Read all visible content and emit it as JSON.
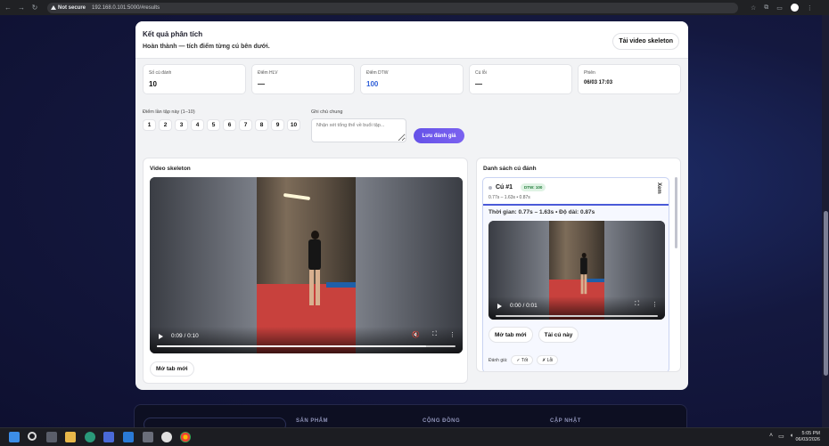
{
  "browser": {
    "security": "Not secure",
    "url": "192.168.0.101:5000/#results"
  },
  "header": {
    "title": "Kết quả phân tích",
    "subtitle": "Hoàn thành — tích điểm từng cú bên dưới.",
    "download_button": "Tải video skeleton"
  },
  "stats": [
    {
      "label": "Số cú đánh",
      "value": "10"
    },
    {
      "label": "Điểm HLV",
      "value": "—"
    },
    {
      "label": "Điểm DTW",
      "value": "100"
    },
    {
      "label": "Cú lỗi",
      "value": "—"
    },
    {
      "label": "Phiên",
      "value": "06/03 17:03"
    }
  ],
  "rating": {
    "label": "Điểm lần tập này (1–10)",
    "options": [
      "1",
      "2",
      "3",
      "4",
      "5",
      "6",
      "7",
      "8",
      "9",
      "10"
    ]
  },
  "note": {
    "label": "Ghi chú chung",
    "placeholder": "Nhận xét tổng thể về buổi tập..."
  },
  "save_button": "Lưu đánh giá",
  "video_panel": {
    "title": "Video skeleton",
    "time": "0:09 / 0:10",
    "progress": 0.9,
    "open_tab": "Mở tab mới"
  },
  "strokes_panel": {
    "title": "Danh sách cú đánh",
    "stroke": {
      "name": "Cú #1",
      "badge": "DTW: 100",
      "range": "0.77s – 1.63s • 0.87s",
      "close": "Xem",
      "info": "Thời gian: 0.77s – 1.63s  •  Độ dài: 0.87s",
      "time": "0:00 / 0:01",
      "progress": 0.0,
      "open_tab": "Mở tab mới",
      "download": "Tải cú này",
      "eval_label": "Đánh giá:",
      "good": "✓ Tốt",
      "bad": "✗ Lỗi"
    }
  },
  "footer": {
    "col1": "SẢN PHẨM",
    "col2": "CỘNG ĐỒNG",
    "col3": "CẬP NHẬT"
  },
  "taskbar": {
    "time": "5:05 PM",
    "date": "06/03/2026"
  }
}
